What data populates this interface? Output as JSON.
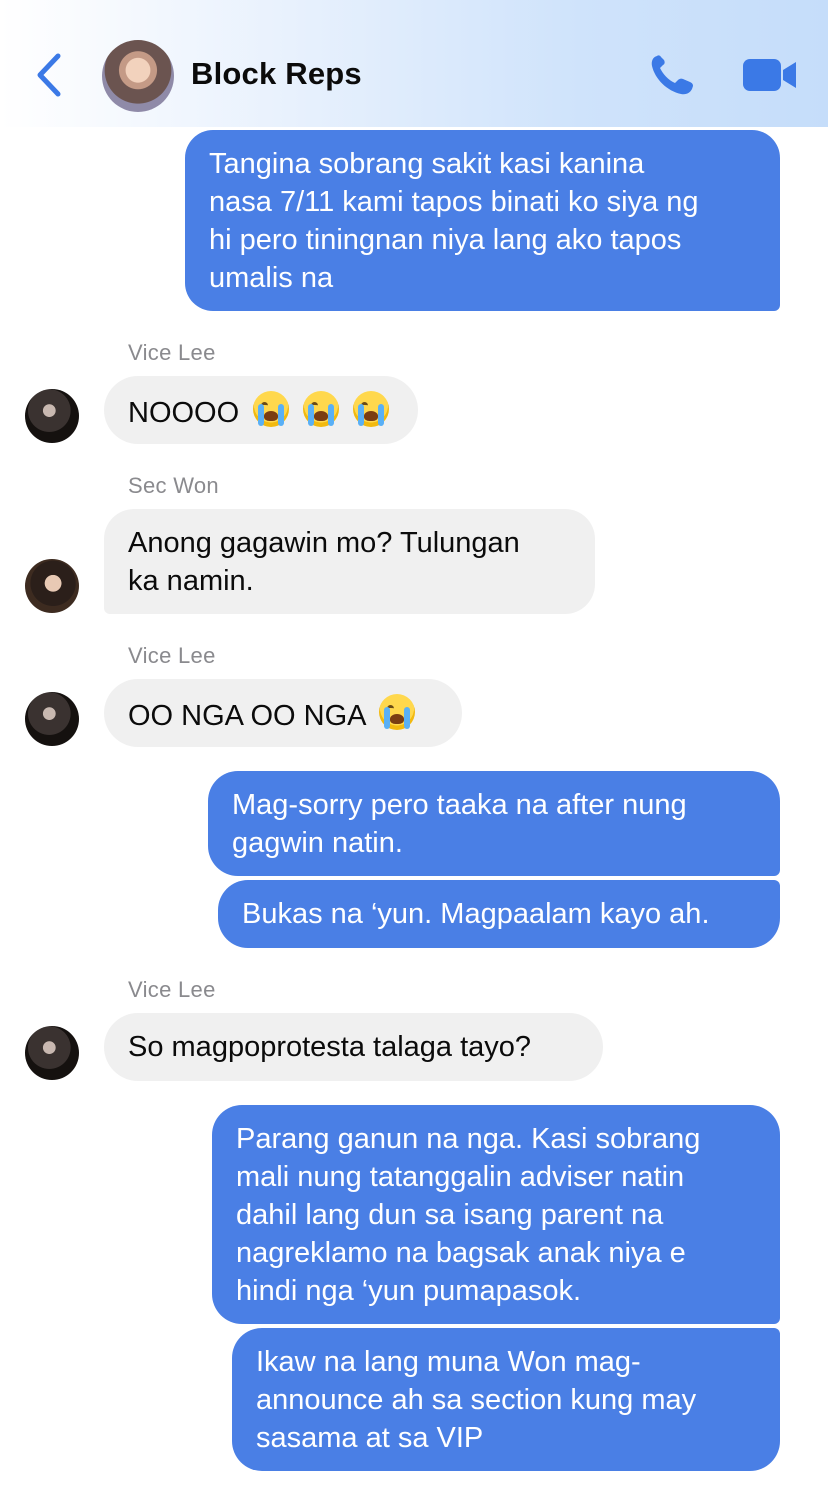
{
  "header": {
    "title": "Block Reps"
  },
  "colors": {
    "accent": "#3b79e6",
    "outgoing_bubble": "#4a7fe5",
    "incoming_bubble": "#f0f0f0",
    "sender_name": "#8a8a8e"
  },
  "messages": [
    {
      "direction": "out",
      "lines": [
        "Tangina sobrang sakit kasi kanina",
        "nasa 7/11 kami tapos binati ko siya ng",
        "hi pero tiningnan niya lang ako tapos",
        "umalis na"
      ]
    },
    {
      "direction": "in",
      "sender": "Vice Lee",
      "text": "NOOOO",
      "emojis": [
        "loudly-crying-face",
        "loudly-crying-face",
        "loudly-crying-face"
      ]
    },
    {
      "direction": "in",
      "sender": "Sec Won",
      "lines": [
        "Anong gagawin mo? Tulungan",
        "ka namin."
      ]
    },
    {
      "direction": "in",
      "sender": "Vice Lee",
      "text": "OO NGA OO NGA",
      "emojis": [
        "loudly-crying-face"
      ]
    },
    {
      "direction": "out",
      "lines": [
        "Mag-sorry pero taaka na after nung",
        "gagwin natin."
      ]
    },
    {
      "direction": "out",
      "text": "Bukas na ‘yun. Magpaalam kayo ah."
    },
    {
      "direction": "in",
      "sender": "Vice Lee",
      "text": "So magpoprotesta talaga tayo?"
    },
    {
      "direction": "out",
      "lines": [
        "Parang ganun na nga. Kasi sobrang",
        "mali nung tatanggalin adviser natin",
        "dahil lang dun sa isang parent na",
        "nagreklamo na bagsak anak niya e",
        "hindi nga ‘yun pumapasok."
      ]
    },
    {
      "direction": "out",
      "lines": [
        "Ikaw na lang muna Won mag-",
        "announce ah sa section kung may",
        "sasama at sa VIP"
      ]
    }
  ]
}
